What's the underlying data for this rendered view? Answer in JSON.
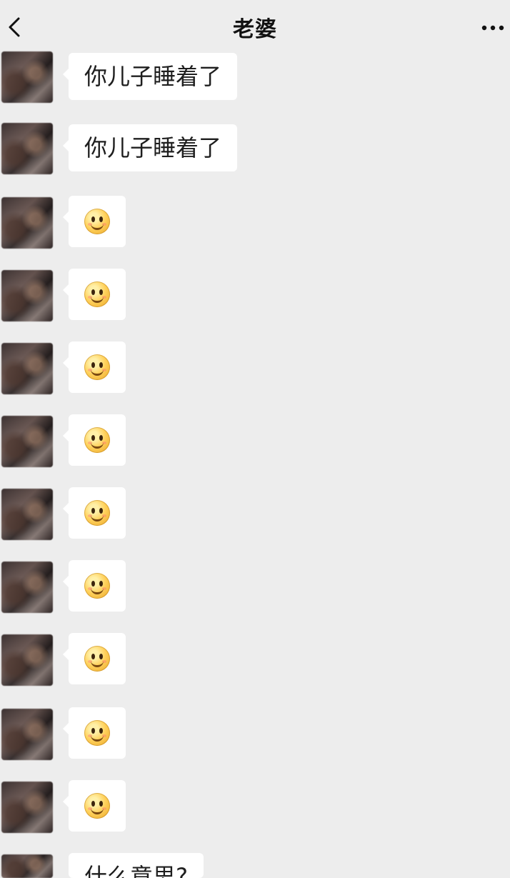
{
  "header": {
    "title": "老婆",
    "back_icon": "back-chevron-icon",
    "more_icon": "more-options-icon"
  },
  "messages": [
    {
      "type": "text",
      "text": "你儿子睡着了"
    },
    {
      "type": "text",
      "text": "你儿子睡着了"
    },
    {
      "type": "emoji",
      "emoji_name": "smile-emoji-icon"
    },
    {
      "type": "emoji",
      "emoji_name": "smile-emoji-icon"
    },
    {
      "type": "emoji",
      "emoji_name": "smile-emoji-icon"
    },
    {
      "type": "emoji",
      "emoji_name": "smile-emoji-icon"
    },
    {
      "type": "emoji",
      "emoji_name": "smile-emoji-icon"
    },
    {
      "type": "emoji",
      "emoji_name": "smile-emoji-icon"
    },
    {
      "type": "emoji",
      "emoji_name": "smile-emoji-icon"
    },
    {
      "type": "emoji",
      "emoji_name": "smile-emoji-icon"
    },
    {
      "type": "emoji",
      "emoji_name": "smile-emoji-icon"
    },
    {
      "type": "text",
      "text": "什么意思?"
    }
  ],
  "colors": {
    "background": "#ededed",
    "bubble": "#ffffff",
    "text": "#1e1e1e"
  }
}
